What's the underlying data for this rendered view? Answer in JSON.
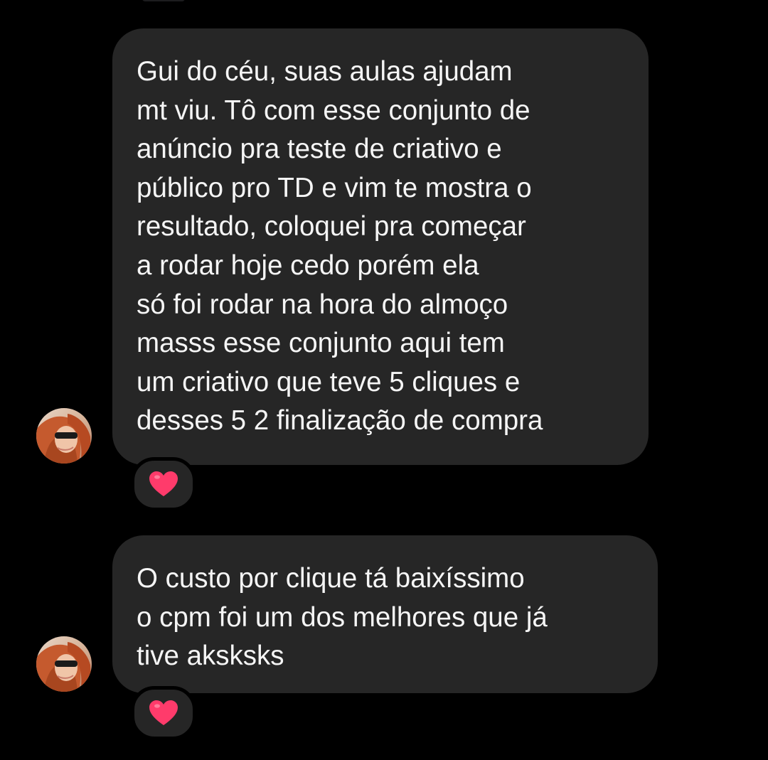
{
  "conversation": {
    "messages": [
      {
        "sender": "contact",
        "avatar": "contact-avatar-photo",
        "lines": [
          "Gui do céu, suas aulas ajudam",
          "mt viu. Tô com esse conjunto de",
          "anúncio pra teste de criativo e",
          "público pro TD e vim te mostra o",
          "resultado, coloquei pra começar",
          "a rodar hoje cedo porém ela",
          "só foi rodar na hora do almoço",
          "masss esse conjunto aqui tem",
          "um criativo que teve 5 cliques e",
          "desses 5 2 finalização de compra"
        ],
        "reaction": "heart-icon",
        "reaction_color": "#ff3b6b"
      },
      {
        "sender": "contact",
        "avatar": "contact-avatar-photo",
        "lines": [
          "O custo por clique tá baixíssimo",
          "o cpm foi um dos melhores que já",
          "tive aksksks"
        ],
        "reaction": "heart-icon",
        "reaction_color": "#ff3b6b"
      }
    ]
  },
  "colors": {
    "background": "#000000",
    "bubble": "#262626",
    "text": "#f5f5f5"
  }
}
